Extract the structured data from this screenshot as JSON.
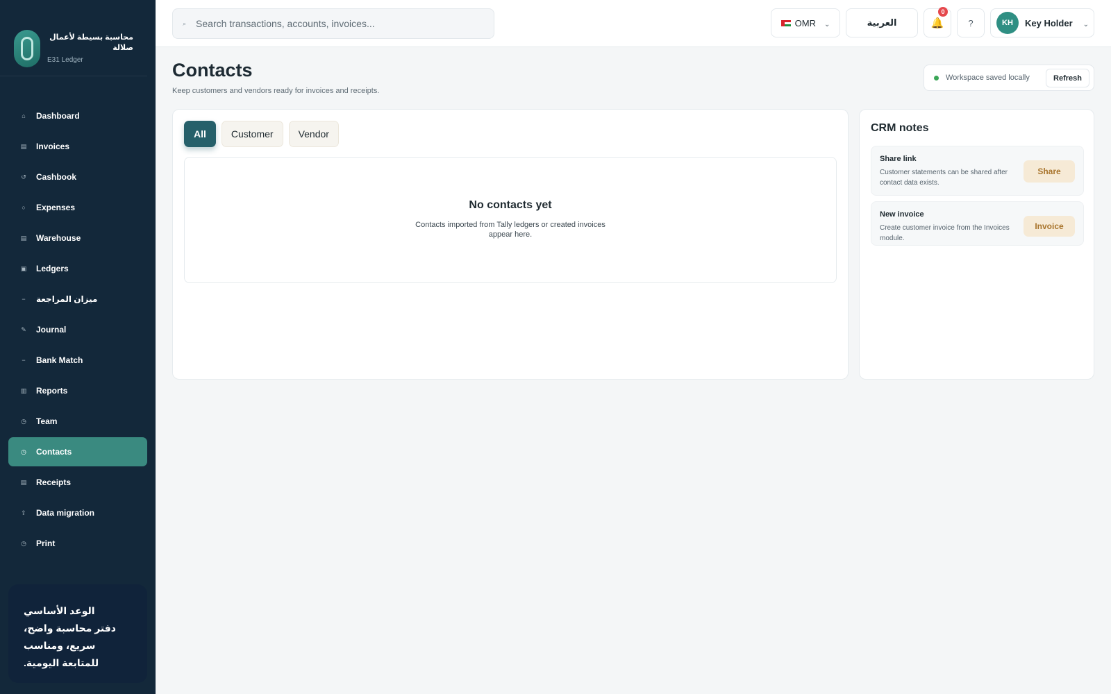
{
  "brand": {
    "name": "محاسبة بسيطة لأعمال صلالة",
    "subtitle": "E31 Ledger"
  },
  "sidebar": {
    "items": [
      {
        "label": "Dashboard",
        "icon": "home-icon",
        "glyph": "⌂",
        "active": false
      },
      {
        "label": "Invoices",
        "icon": "invoice-icon",
        "glyph": "▤",
        "active": false
      },
      {
        "label": "Cashbook",
        "icon": "cashbook-icon",
        "glyph": "↺",
        "active": false
      },
      {
        "label": "Expenses",
        "icon": "expenses-icon",
        "glyph": "○",
        "active": false
      },
      {
        "label": "Warehouse",
        "icon": "warehouse-icon",
        "glyph": "▤",
        "active": false
      },
      {
        "label": "Ledgers",
        "icon": "ledger-icon",
        "glyph": "▣",
        "active": false
      },
      {
        "label": "ميزان المراجعة",
        "icon": "trial-balance-icon",
        "glyph": "−",
        "active": false
      },
      {
        "label": "Journal",
        "icon": "journal-icon",
        "glyph": "✎",
        "active": false
      },
      {
        "label": "Bank Match",
        "icon": "bank-match-icon",
        "glyph": "−",
        "active": false
      },
      {
        "label": "Reports",
        "icon": "reports-icon",
        "glyph": "▥",
        "active": false
      },
      {
        "label": "Team",
        "icon": "team-icon",
        "glyph": "◷",
        "active": false
      },
      {
        "label": "Contacts",
        "icon": "contacts-icon",
        "glyph": "◷",
        "active": true
      },
      {
        "label": "Receipts",
        "icon": "receipt-icon",
        "glyph": "▤",
        "active": false
      },
      {
        "label": "Data migration",
        "icon": "upload-icon",
        "glyph": "⇪",
        "active": false
      },
      {
        "label": "Print",
        "icon": "print-icon",
        "glyph": "◷",
        "active": false
      }
    ],
    "promise_title": "الوعد الأساسي",
    "promise_body": "دفتر محاسبة واضح، سريع، ومناسب للمتابعة اليومية."
  },
  "topbar": {
    "search_placeholder": "Search transactions, accounts, invoices...",
    "currency": "OMR",
    "language": "العربية",
    "notifications_count": "0",
    "help": "?",
    "user_initials": "KH",
    "user_name": "Key Holder"
  },
  "page": {
    "title": "Contacts",
    "subtitle": "Keep customers and vendors ready for invoices and receipts.",
    "status": "Workspace saved locally",
    "refresh": "Refresh"
  },
  "tabs": [
    "All",
    "Customer",
    "Vendor"
  ],
  "active_tab": 0,
  "empty_state": {
    "title": "No contacts yet",
    "text": "Contacts imported from Tally ledgers or created invoices appear here."
  },
  "crm": {
    "title": "CRM notes",
    "notes": [
      {
        "title": "Share link",
        "text": "Customer statements can be shared after contact data exists.",
        "button": "Share"
      },
      {
        "title": "New invoice",
        "text": "Create customer invoice from the Invoices module.",
        "button": "Invoice"
      }
    ]
  },
  "colors": {
    "sidebar_bg": "#13283a",
    "accent": "#3a8a80",
    "active_tab": "#26606a",
    "status_ok": "#3aa657",
    "badge": "#e5484d"
  }
}
